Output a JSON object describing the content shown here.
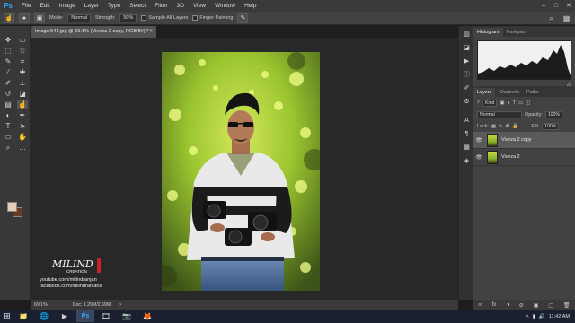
{
  "app": {
    "logo": "Ps"
  },
  "menu": [
    "File",
    "Edit",
    "Image",
    "Layer",
    "Type",
    "Select",
    "Filter",
    "3D",
    "View",
    "Window",
    "Help"
  ],
  "window_controls": [
    "–",
    "□",
    "✕"
  ],
  "options": {
    "mode_label": "Mode:",
    "mode_value": "Normal",
    "strength_label": "Strength:",
    "strength_value": "50%",
    "sample_all_layers": "Sample All Layers",
    "finger_painting": "Finger Painting"
  },
  "tools": [
    {
      "name": "move-tool-icon",
      "glyph": "✥"
    },
    {
      "name": "artboard-tool-icon",
      "glyph": "▭"
    },
    {
      "name": "marquee-tool-icon",
      "glyph": "⬚"
    },
    {
      "name": "lasso-tool-icon",
      "glyph": "➰"
    },
    {
      "name": "quick-select-tool-icon",
      "glyph": "✎"
    },
    {
      "name": "crop-tool-icon",
      "glyph": "⌗"
    },
    {
      "name": "eyedropper-tool-icon",
      "glyph": "⁄"
    },
    {
      "name": "healing-tool-icon",
      "glyph": "✚"
    },
    {
      "name": "brush-tool-icon",
      "glyph": "✐"
    },
    {
      "name": "stamp-tool-icon",
      "glyph": "⊥"
    },
    {
      "name": "history-brush-tool-icon",
      "glyph": "↺"
    },
    {
      "name": "eraser-tool-icon",
      "glyph": "◪"
    },
    {
      "name": "gradient-tool-icon",
      "glyph": "▤"
    },
    {
      "name": "smudge-tool-icon",
      "glyph": "☝"
    },
    {
      "name": "dodge-tool-icon",
      "glyph": "◐"
    },
    {
      "name": "pen-tool-icon",
      "glyph": "✒"
    },
    {
      "name": "type-tool-icon",
      "glyph": "T"
    },
    {
      "name": "path-select-tool-icon",
      "glyph": "➤"
    },
    {
      "name": "shape-tool-icon",
      "glyph": "▭"
    },
    {
      "name": "hand-tool-icon",
      "glyph": "✋"
    },
    {
      "name": "zoom-tool-icon",
      "glyph": "⌕"
    },
    {
      "name": "more-tools-icon",
      "glyph": "…"
    }
  ],
  "document": {
    "tab_title": "Image 544.jpg @ 69.1% (Viveza 2 copy, RGB/8#) *",
    "zoom": "69.1%",
    "doc_size": "Doc: 1.29M/2.59M"
  },
  "watermark": {
    "logo_text": "MILIND",
    "logo_sub": "CREATION",
    "youtube": "youtube.com/milindranjan",
    "facebook": "facebook.com/milindranjans"
  },
  "panels": {
    "top_tabs": [
      "Histogram",
      "Navigator"
    ],
    "layer_tabs": [
      "Layers",
      "Channels",
      "Paths"
    ],
    "kind_label": "Kind",
    "blend_mode": "Normal",
    "opacity_label": "Opacity:",
    "opacity_value": "100%",
    "lock_label": "Lock:",
    "fill_label": "Fill:",
    "fill_value": "100%",
    "layers": [
      {
        "name": "Viveza 2 copy",
        "selected": true
      },
      {
        "name": "Viveza 2",
        "selected": false
      }
    ],
    "footer_icons": [
      "∞",
      "fx",
      "◑",
      "⊘",
      "▣",
      "▢",
      "🗑"
    ]
  },
  "taskbar": {
    "time": "11:42 AM",
    "apps": [
      "📁",
      "🌐",
      "▶",
      "Ps",
      "🎞",
      "📷",
      "🦊"
    ]
  },
  "colors": {
    "foreground": "#e8cdb8",
    "background": "#6a3a26",
    "accent": "#31a8ff"
  }
}
